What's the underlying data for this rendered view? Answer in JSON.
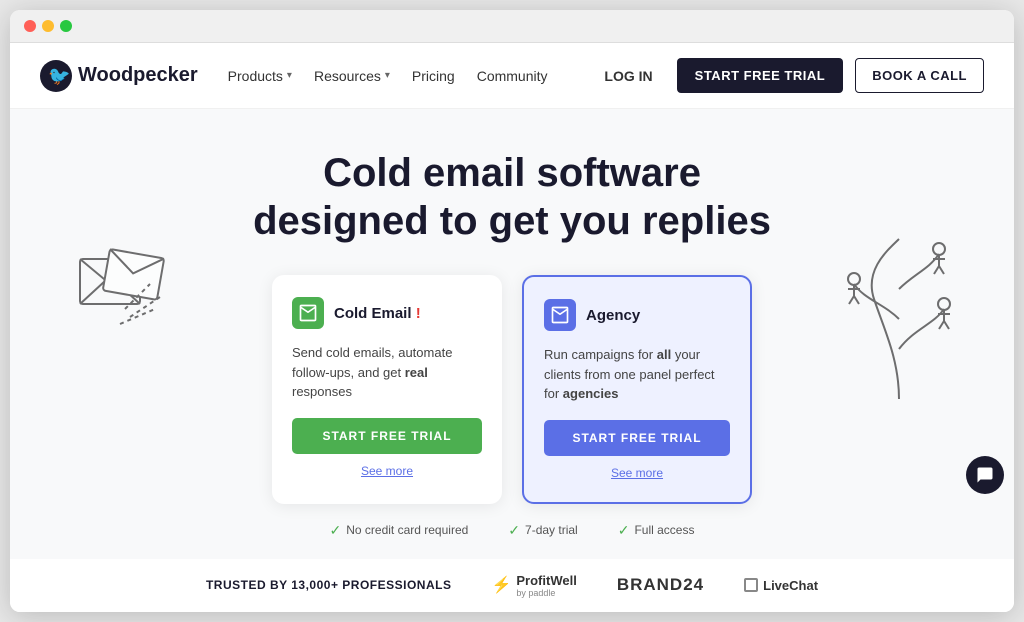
{
  "browser": {
    "dots": [
      "red",
      "yellow",
      "green"
    ]
  },
  "navbar": {
    "logo_text": "Woodpecker",
    "nav_items": [
      {
        "label": "Products",
        "has_dropdown": true
      },
      {
        "label": "Resources",
        "has_dropdown": true
      },
      {
        "label": "Pricing",
        "has_dropdown": false
      },
      {
        "label": "Community",
        "has_dropdown": false
      }
    ],
    "login_label": "LOG IN",
    "start_trial_label": "START FREE TRIAL",
    "book_call_label": "BOOK A CALL"
  },
  "hero": {
    "title_line1": "Cold email software",
    "title_line2": "designed to get you replies"
  },
  "cards": [
    {
      "id": "cold-email",
      "title": "Cold Email",
      "title_highlight": "!",
      "desc": "Send cold emails, automate follow-ups, and get real responses",
      "btn_label": "START FREE TRIAL",
      "see_more": "See more",
      "style": "green"
    },
    {
      "id": "agency",
      "title": "Agency",
      "desc": "Run campaigns for all your clients from one panel perfect for agencies",
      "btn_label": "START FREE TRIAL",
      "see_more": "See more",
      "style": "blue"
    }
  ],
  "trust_checks": [
    {
      "label": "No credit card required"
    },
    {
      "label": "7-day trial"
    },
    {
      "label": "Full access"
    }
  ],
  "trusted": {
    "label": "TRUSTED BY 13,000+ PROFESSIONALS",
    "brands": [
      {
        "name": "ProfitWell",
        "sub": "by paddle"
      },
      {
        "name": "BRAND24"
      },
      {
        "name": "LiveChat"
      }
    ]
  }
}
